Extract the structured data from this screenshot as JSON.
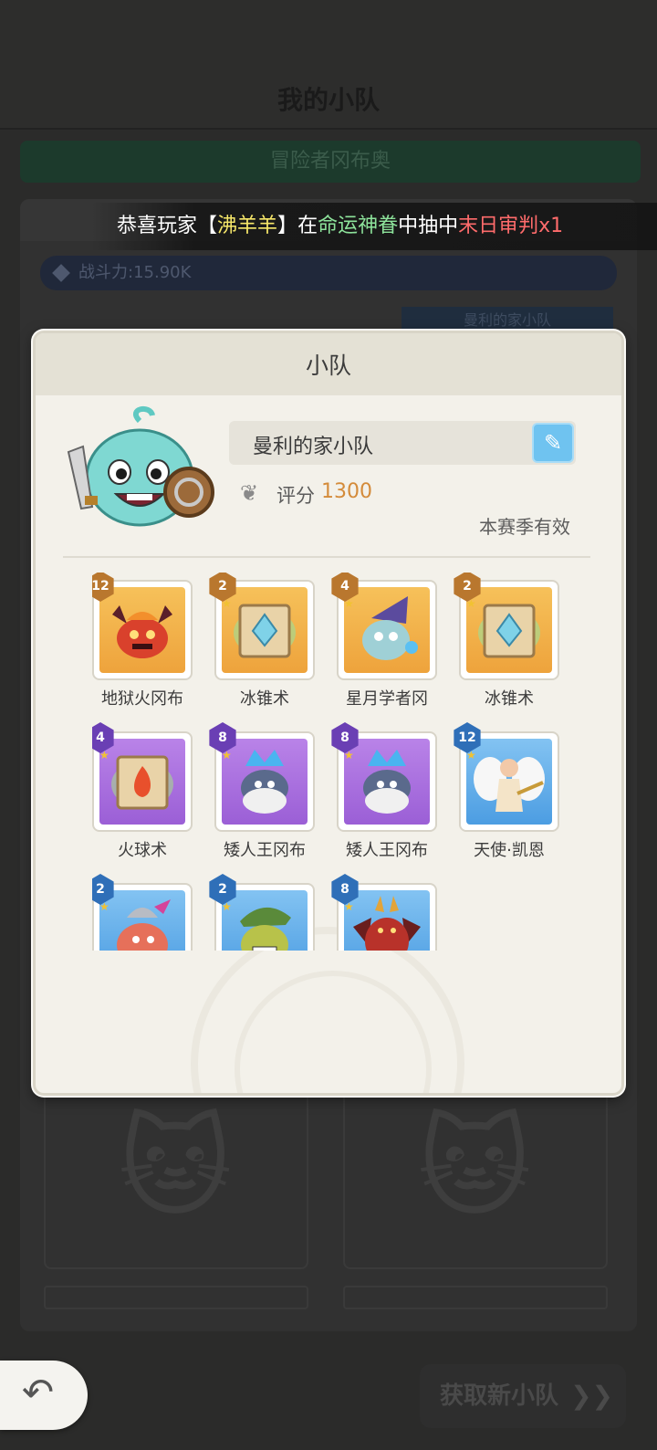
{
  "page": {
    "title": "我的小队"
  },
  "background": {
    "subheader": "冒险者冈布奥",
    "power": "战斗力:15.90K",
    "team_name": "曼利的家小队"
  },
  "banner": {
    "prefix": "恭喜玩家",
    "bracket_open": "【",
    "player": "沸羊羊",
    "bracket_close": "】",
    "word_in": "在",
    "pool": "命运神眷",
    "word_draw": "中抽中",
    "item": "末日审判x1"
  },
  "modal": {
    "title": "小队",
    "team_name": "曼利的家小队",
    "score_label": "评分",
    "score_value": "1300",
    "season_note": "本赛季有效",
    "colors": {
      "score": "#d48b3a",
      "edit_button": "#6fc3f0"
    },
    "members": [
      {
        "name": "地狱火冈布",
        "level": "12",
        "rarity": "orange",
        "icon": "hellfire-slime-icon"
      },
      {
        "name": "冰锥术",
        "level": "2",
        "rarity": "orange",
        "icon": "ice-scroll-icon"
      },
      {
        "name": "星月学者冈",
        "level": "4",
        "rarity": "orange",
        "icon": "wizard-slime-icon"
      },
      {
        "name": "冰锥术",
        "level": "2",
        "rarity": "orange",
        "icon": "ice-scroll-icon"
      },
      {
        "name": "火球术",
        "level": "4",
        "rarity": "purple",
        "icon": "fire-scroll-icon"
      },
      {
        "name": "矮人王冈布",
        "level": "8",
        "rarity": "purple",
        "icon": "dwarf-king-icon"
      },
      {
        "name": "矮人王冈布",
        "level": "8",
        "rarity": "purple",
        "icon": "dwarf-king-icon"
      },
      {
        "name": "天使·凯恩",
        "level": "12",
        "rarity": "blue",
        "icon": "angel-icon"
      },
      {
        "name": "",
        "level": "2",
        "rarity": "blue",
        "icon": "knight-slime-icon"
      },
      {
        "name": "",
        "level": "2",
        "rarity": "blue",
        "icon": "goblin-ranger-icon"
      },
      {
        "name": "",
        "level": "8",
        "rarity": "blue",
        "icon": "demon-icon"
      }
    ]
  },
  "bottom": {
    "new_team": "获取新小队",
    "back_icon": "back-arrow-icon"
  }
}
